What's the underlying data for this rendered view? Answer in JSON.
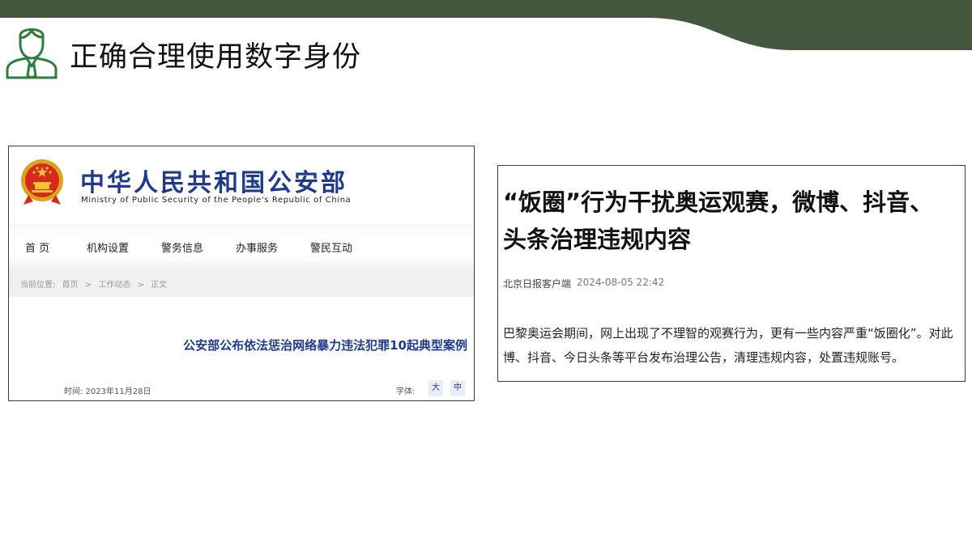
{
  "slide": {
    "title": "正确合理使用数字身份",
    "theme_color": "#44573f",
    "icon": "person-tie-icon"
  },
  "mps_site": {
    "name_cn": "中华人民共和国公安部",
    "name_en": "Ministry of Public Security of the People's Republic of China",
    "emblem_icon": "national-emblem-icon",
    "nav": [
      {
        "label": "首 页"
      },
      {
        "label": "机构设置"
      },
      {
        "label": "警务信息"
      },
      {
        "label": "办事服务"
      },
      {
        "label": "警民互动"
      }
    ],
    "breadcrumb": {
      "prefix": "当前位置:",
      "items": [
        "首页",
        ">",
        "工作动态",
        ">",
        "正文"
      ]
    },
    "article_title": "公安部公布依法惩治网络暴力违法犯罪10起典型案例",
    "time_label": "时间: 2023年11月28日",
    "font_label": "字体:",
    "font_large": "大",
    "font_medium": "中",
    "brand_color": "#1f3a8a"
  },
  "news": {
    "headline_line1": "“饭圈”行为干扰奥运观赛，微博、抖音、",
    "headline_line2": "头条治理违规内容",
    "source": "北京日报客户端",
    "timestamp": "2024-08-05 22:42",
    "body_line1": "巴黎奥运会期间，网上出现了不理智的观赛行为，更有一些内容严重“饭圈化”。对此",
    "body_line2": "博、抖音、今日头条等平台发布治理公告，清理违规内容，处置违规账号。"
  }
}
